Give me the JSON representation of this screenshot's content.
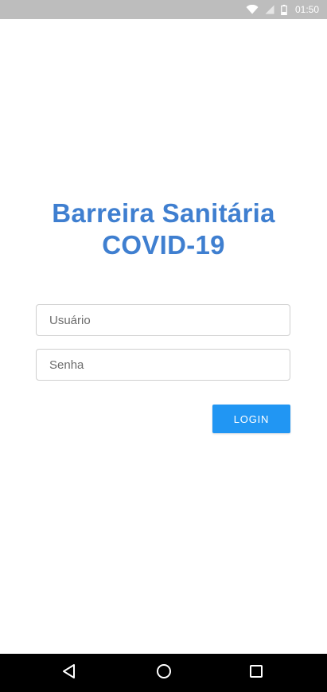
{
  "status_bar": {
    "time": "01:50",
    "icons": [
      "wifi-icon",
      "signal-icon",
      "battery-icon"
    ]
  },
  "title": {
    "line1": "Barreira Sanitária",
    "line2": "COVID-19",
    "color": "#3f7fd0"
  },
  "form": {
    "username_placeholder": "Usuário",
    "password_placeholder": "Senha",
    "login_label": "LOGIN",
    "accent_color": "#2196f3"
  },
  "nav_bar": {
    "buttons": [
      "back-icon",
      "home-icon",
      "recents-icon"
    ]
  }
}
